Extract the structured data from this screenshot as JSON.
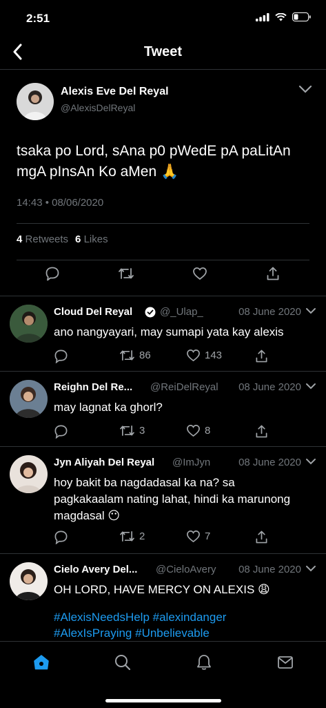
{
  "status": {
    "time": "2:51"
  },
  "nav": {
    "title": "Tweet"
  },
  "tweet": {
    "name": "Alexis Eve Del Reyal",
    "handle": "@AlexisDelReyal",
    "text": "tsaka po Lord, sAna p0 pWedE pA paLitAn mgA pInsAn Ko aMen 🙏",
    "timestamp": "14:43 • 08/06/2020",
    "retweets_count": "4",
    "retweets_label": "Retweets",
    "likes_count": "6",
    "likes_label": "Likes"
  },
  "replies": [
    {
      "name": "Cloud Del Reyal",
      "verified": true,
      "handle": "@_Ulap_",
      "date": "08 June 2020",
      "text": "ano nangyayari, may sumapi yata kay alexis",
      "retweets": "86",
      "likes": "143"
    },
    {
      "name": "Reighn Del Re...",
      "handle": "@ReiDelReyal",
      "date": "08 June 2020",
      "text": "may lagnat ka ghorl?",
      "retweets": "3",
      "likes": "8"
    },
    {
      "name": "Jyn Aliyah Del Reyal",
      "handle": "@ImJyn",
      "date": "08 June 2020",
      "text": "hoy bakit ba nagdadasal ka na? sa pagkakaalam nating lahat, hindi ka marunong magdasal 😶",
      "retweets": "2",
      "likes": "7"
    },
    {
      "name": "Cielo Avery Del...",
      "handle": "@CieloAvery",
      "date": "08 June 2020",
      "text": "OH LORD, HAVE MERCY ON ALEXIS 😩",
      "hashtags_line1": "#AlexisNeedsHelp #alexindanger",
      "hashtags_line2": "#AlexIsPraying #Unbelievable"
    }
  ],
  "colors": {
    "accent": "#1d9bf0",
    "muted": "#71767b",
    "divider": "#2f3336"
  },
  "icons": [
    "back-icon",
    "chevron-down-icon",
    "reply-icon",
    "retweet-icon",
    "like-icon",
    "share-icon",
    "verified-icon",
    "home-icon",
    "search-icon",
    "notifications-icon",
    "messages-icon"
  ]
}
